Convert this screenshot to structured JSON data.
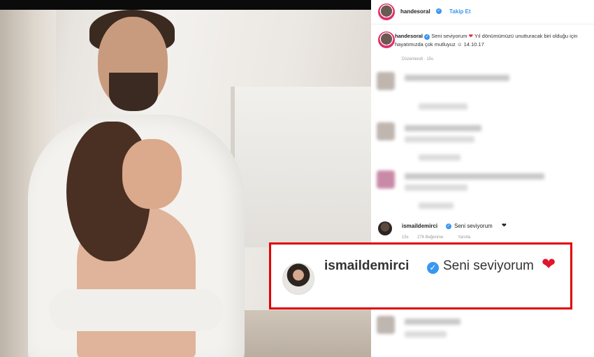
{
  "header": {
    "username": "handesoral",
    "follow_label": "Takip Et"
  },
  "caption": {
    "username": "handesoral",
    "text": "Seni seviyorum",
    "rest": "Yıl dönümümüzü unutturacak biri olduğu için hayatımızda çok mutluyuz",
    "date": "14.10.17",
    "edited": "Düzenlendi · 15s"
  },
  "comment": {
    "username": "ismaildemirci",
    "text": "Seni seviyorum",
    "meta_time": "15s",
    "meta_likes": "276 Beğenme",
    "meta_reply": "Yanıtla"
  },
  "highlight": {
    "username": "ismaildemirci",
    "text": "Seni seviyorum"
  },
  "colors": {
    "accent_blue": "#3897f0",
    "heart_red": "#e0162b",
    "highlight_border": "#e00000"
  }
}
